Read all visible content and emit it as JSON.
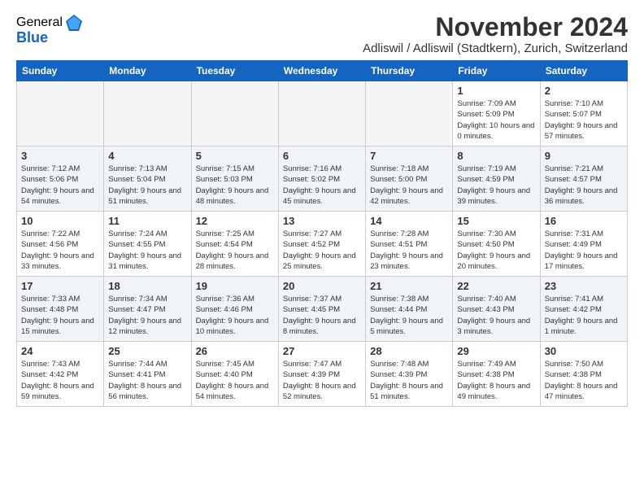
{
  "logo": {
    "general": "General",
    "blue": "Blue"
  },
  "title": "November 2024",
  "subtitle": "Adliswil / Adliswil (Stadtkern), Zurich, Switzerland",
  "days_of_week": [
    "Sunday",
    "Monday",
    "Tuesday",
    "Wednesday",
    "Thursday",
    "Friday",
    "Saturday"
  ],
  "weeks": [
    [
      {
        "day": "",
        "sunrise": "",
        "sunset": "",
        "daylight": "",
        "empty": true
      },
      {
        "day": "",
        "sunrise": "",
        "sunset": "",
        "daylight": "",
        "empty": true
      },
      {
        "day": "",
        "sunrise": "",
        "sunset": "",
        "daylight": "",
        "empty": true
      },
      {
        "day": "",
        "sunrise": "",
        "sunset": "",
        "daylight": "",
        "empty": true
      },
      {
        "day": "",
        "sunrise": "",
        "sunset": "",
        "daylight": "",
        "empty": true
      },
      {
        "day": "1",
        "sunrise": "Sunrise: 7:09 AM",
        "sunset": "Sunset: 5:09 PM",
        "daylight": "Daylight: 10 hours and 0 minutes.",
        "empty": false
      },
      {
        "day": "2",
        "sunrise": "Sunrise: 7:10 AM",
        "sunset": "Sunset: 5:07 PM",
        "daylight": "Daylight: 9 hours and 57 minutes.",
        "empty": false
      }
    ],
    [
      {
        "day": "3",
        "sunrise": "Sunrise: 7:12 AM",
        "sunset": "Sunset: 5:06 PM",
        "daylight": "Daylight: 9 hours and 54 minutes.",
        "empty": false
      },
      {
        "day": "4",
        "sunrise": "Sunrise: 7:13 AM",
        "sunset": "Sunset: 5:04 PM",
        "daylight": "Daylight: 9 hours and 51 minutes.",
        "empty": false
      },
      {
        "day": "5",
        "sunrise": "Sunrise: 7:15 AM",
        "sunset": "Sunset: 5:03 PM",
        "daylight": "Daylight: 9 hours and 48 minutes.",
        "empty": false
      },
      {
        "day": "6",
        "sunrise": "Sunrise: 7:16 AM",
        "sunset": "Sunset: 5:02 PM",
        "daylight": "Daylight: 9 hours and 45 minutes.",
        "empty": false
      },
      {
        "day": "7",
        "sunrise": "Sunrise: 7:18 AM",
        "sunset": "Sunset: 5:00 PM",
        "daylight": "Daylight: 9 hours and 42 minutes.",
        "empty": false
      },
      {
        "day": "8",
        "sunrise": "Sunrise: 7:19 AM",
        "sunset": "Sunset: 4:59 PM",
        "daylight": "Daylight: 9 hours and 39 minutes.",
        "empty": false
      },
      {
        "day": "9",
        "sunrise": "Sunrise: 7:21 AM",
        "sunset": "Sunset: 4:57 PM",
        "daylight": "Daylight: 9 hours and 36 minutes.",
        "empty": false
      }
    ],
    [
      {
        "day": "10",
        "sunrise": "Sunrise: 7:22 AM",
        "sunset": "Sunset: 4:56 PM",
        "daylight": "Daylight: 9 hours and 33 minutes.",
        "empty": false
      },
      {
        "day": "11",
        "sunrise": "Sunrise: 7:24 AM",
        "sunset": "Sunset: 4:55 PM",
        "daylight": "Daylight: 9 hours and 31 minutes.",
        "empty": false
      },
      {
        "day": "12",
        "sunrise": "Sunrise: 7:25 AM",
        "sunset": "Sunset: 4:54 PM",
        "daylight": "Daylight: 9 hours and 28 minutes.",
        "empty": false
      },
      {
        "day": "13",
        "sunrise": "Sunrise: 7:27 AM",
        "sunset": "Sunset: 4:52 PM",
        "daylight": "Daylight: 9 hours and 25 minutes.",
        "empty": false
      },
      {
        "day": "14",
        "sunrise": "Sunrise: 7:28 AM",
        "sunset": "Sunset: 4:51 PM",
        "daylight": "Daylight: 9 hours and 23 minutes.",
        "empty": false
      },
      {
        "day": "15",
        "sunrise": "Sunrise: 7:30 AM",
        "sunset": "Sunset: 4:50 PM",
        "daylight": "Daylight: 9 hours and 20 minutes.",
        "empty": false
      },
      {
        "day": "16",
        "sunrise": "Sunrise: 7:31 AM",
        "sunset": "Sunset: 4:49 PM",
        "daylight": "Daylight: 9 hours and 17 minutes.",
        "empty": false
      }
    ],
    [
      {
        "day": "17",
        "sunrise": "Sunrise: 7:33 AM",
        "sunset": "Sunset: 4:48 PM",
        "daylight": "Daylight: 9 hours and 15 minutes.",
        "empty": false
      },
      {
        "day": "18",
        "sunrise": "Sunrise: 7:34 AM",
        "sunset": "Sunset: 4:47 PM",
        "daylight": "Daylight: 9 hours and 12 minutes.",
        "empty": false
      },
      {
        "day": "19",
        "sunrise": "Sunrise: 7:36 AM",
        "sunset": "Sunset: 4:46 PM",
        "daylight": "Daylight: 9 hours and 10 minutes.",
        "empty": false
      },
      {
        "day": "20",
        "sunrise": "Sunrise: 7:37 AM",
        "sunset": "Sunset: 4:45 PM",
        "daylight": "Daylight: 9 hours and 8 minutes.",
        "empty": false
      },
      {
        "day": "21",
        "sunrise": "Sunrise: 7:38 AM",
        "sunset": "Sunset: 4:44 PM",
        "daylight": "Daylight: 9 hours and 5 minutes.",
        "empty": false
      },
      {
        "day": "22",
        "sunrise": "Sunrise: 7:40 AM",
        "sunset": "Sunset: 4:43 PM",
        "daylight": "Daylight: 9 hours and 3 minutes.",
        "empty": false
      },
      {
        "day": "23",
        "sunrise": "Sunrise: 7:41 AM",
        "sunset": "Sunset: 4:42 PM",
        "daylight": "Daylight: 9 hours and 1 minute.",
        "empty": false
      }
    ],
    [
      {
        "day": "24",
        "sunrise": "Sunrise: 7:43 AM",
        "sunset": "Sunset: 4:42 PM",
        "daylight": "Daylight: 8 hours and 59 minutes.",
        "empty": false
      },
      {
        "day": "25",
        "sunrise": "Sunrise: 7:44 AM",
        "sunset": "Sunset: 4:41 PM",
        "daylight": "Daylight: 8 hours and 56 minutes.",
        "empty": false
      },
      {
        "day": "26",
        "sunrise": "Sunrise: 7:45 AM",
        "sunset": "Sunset: 4:40 PM",
        "daylight": "Daylight: 8 hours and 54 minutes.",
        "empty": false
      },
      {
        "day": "27",
        "sunrise": "Sunrise: 7:47 AM",
        "sunset": "Sunset: 4:39 PM",
        "daylight": "Daylight: 8 hours and 52 minutes.",
        "empty": false
      },
      {
        "day": "28",
        "sunrise": "Sunrise: 7:48 AM",
        "sunset": "Sunset: 4:39 PM",
        "daylight": "Daylight: 8 hours and 51 minutes.",
        "empty": false
      },
      {
        "day": "29",
        "sunrise": "Sunrise: 7:49 AM",
        "sunset": "Sunset: 4:38 PM",
        "daylight": "Daylight: 8 hours and 49 minutes.",
        "empty": false
      },
      {
        "day": "30",
        "sunrise": "Sunrise: 7:50 AM",
        "sunset": "Sunset: 4:38 PM",
        "daylight": "Daylight: 8 hours and 47 minutes.",
        "empty": false
      }
    ]
  ]
}
